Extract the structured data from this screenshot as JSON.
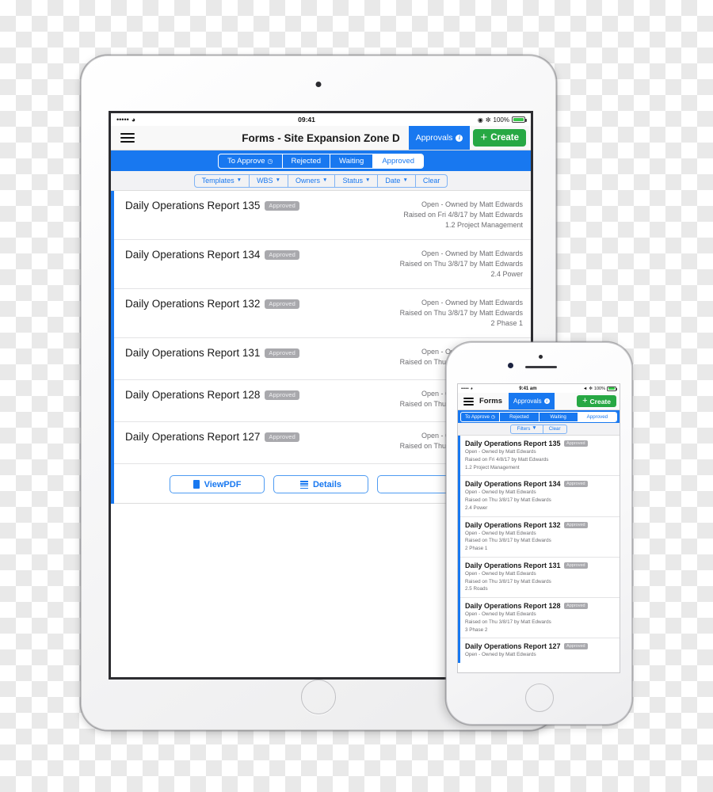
{
  "tablet": {
    "statusbar": {
      "signal": "•••••",
      "wifi": "wifi-icon",
      "time": "09:41",
      "alarm": "◉",
      "bluetooth": "✼",
      "battery_pct": "100%"
    },
    "navbar": {
      "menu_icon": "hamburger-icon",
      "title": "Forms - Site Expansion Zone D",
      "approvals_label": "Approvals",
      "approvals_badge": "i",
      "create_label": "Create",
      "create_plus": "+"
    },
    "segments": [
      {
        "label": "To Approve",
        "icon": "clock-icon",
        "active": false
      },
      {
        "label": "Rejected",
        "active": false
      },
      {
        "label": "Waiting",
        "active": false
      },
      {
        "label": "Approved",
        "active": true
      }
    ],
    "filters": [
      {
        "label": "Templates",
        "caret": "▼"
      },
      {
        "label": "WBS",
        "caret": "▼"
      },
      {
        "label": "Owners",
        "caret": "▼"
      },
      {
        "label": "Status",
        "caret": "▼"
      },
      {
        "label": "Date",
        "caret": "▼"
      },
      {
        "label": "Clear",
        "caret": ""
      }
    ],
    "rows": [
      {
        "title": "Daily Operations Report 135",
        "status": "Approved",
        "owner": "Open - Owned by Matt Edwards",
        "raised": "Raised on Fri 4/8/17 by Matt Edwards",
        "wbs": "1.2 Project Management"
      },
      {
        "title": "Daily Operations Report 134",
        "status": "Approved",
        "owner": "Open - Owned by Matt Edwards",
        "raised": "Raised on Thu 3/8/17 by Matt Edwards",
        "wbs": "2.4 Power"
      },
      {
        "title": "Daily Operations Report 132",
        "status": "Approved",
        "owner": "Open - Owned by Matt Edwards",
        "raised": "Raised on Thu 3/8/17 by Matt Edwards",
        "wbs": "2 Phase 1"
      },
      {
        "title": "Daily Operations Report 131",
        "status": "Approved",
        "owner": "Open - Owned by Matt Edwards",
        "raised": "Raised on Thu 3/8/17 by Matt Edwards",
        "wbs": ""
      },
      {
        "title": "Daily Operations Report 128",
        "status": "Approved",
        "owner": "Open - Owned by Matt Edwards",
        "raised": "Raised on Thu 3/8/17 by Matt Edwards",
        "wbs": ""
      },
      {
        "title": "Daily Operations Report 127",
        "status": "Approved",
        "owner": "Open - Owned by Matt Edwards",
        "raised": "Raised on Thu 3/8/17 by Matt Edwards",
        "wbs": ""
      }
    ],
    "actions": [
      {
        "label": "ViewPDF",
        "icon": "pdf-icon"
      },
      {
        "label": "Details",
        "icon": "list-details-icon"
      },
      {
        "label": "",
        "icon": ""
      }
    ]
  },
  "phone": {
    "statusbar": {
      "signal": "•••••",
      "wifi": "wifi-icon",
      "time": "9:41 am",
      "location": "◄",
      "bluetooth": "✼",
      "battery_pct": "100%"
    },
    "navbar": {
      "menu_icon": "hamburger-icon",
      "title": "Forms",
      "approvals_label": "Approvals",
      "approvals_badge": "i",
      "create_label": "Create",
      "create_plus": "+"
    },
    "segments": [
      {
        "label": "To Approve",
        "icon": "clock-icon",
        "active": false
      },
      {
        "label": "Rejected",
        "active": false
      },
      {
        "label": "Waiting",
        "active": false
      },
      {
        "label": "Approved",
        "active": true
      }
    ],
    "filters": [
      {
        "label": "Filters",
        "caret": "▼"
      },
      {
        "label": "Clear",
        "caret": ""
      }
    ],
    "rows": [
      {
        "title": "Daily Operations Report 135",
        "status": "Approved",
        "owner": "Open - Owned by Matt Edwards",
        "raised": "Raised on Fri 4/8/17 by Matt Edwards",
        "wbs": "1.2 Project Management"
      },
      {
        "title": "Daily Operations Report 134",
        "status": "Approved",
        "owner": "Open - Owned by Matt Edwards",
        "raised": "Raised on Thu 3/8/17 by Matt Edwards",
        "wbs": "2.4 Power"
      },
      {
        "title": "Daily Operations Report 132",
        "status": "Approved",
        "owner": "Open - Owned by Matt Edwards",
        "raised": "Raised on Thu 3/8/17 by Matt Edwards",
        "wbs": "2 Phase 1"
      },
      {
        "title": "Daily Operations Report 131",
        "status": "Approved",
        "owner": "Open - Owned by Matt Edwards",
        "raised": "Raised on Thu 3/8/17 by Matt Edwards",
        "wbs": "2.5 Roads"
      },
      {
        "title": "Daily Operations Report 128",
        "status": "Approved",
        "owner": "Open - Owned by Matt Edwards",
        "raised": "Raised on Thu 3/8/17 by Matt Edwards",
        "wbs": "3 Phase 2"
      },
      {
        "title": "Daily Operations Report 127",
        "status": "Approved",
        "owner": "Open - Owned by Matt Edwards",
        "raised": "",
        "wbs": ""
      }
    ]
  },
  "colors": {
    "accent_blue": "#1878f0",
    "create_green": "#27a844",
    "pill_gray": "#a9a9ad",
    "meta_gray": "#6c6c70"
  }
}
